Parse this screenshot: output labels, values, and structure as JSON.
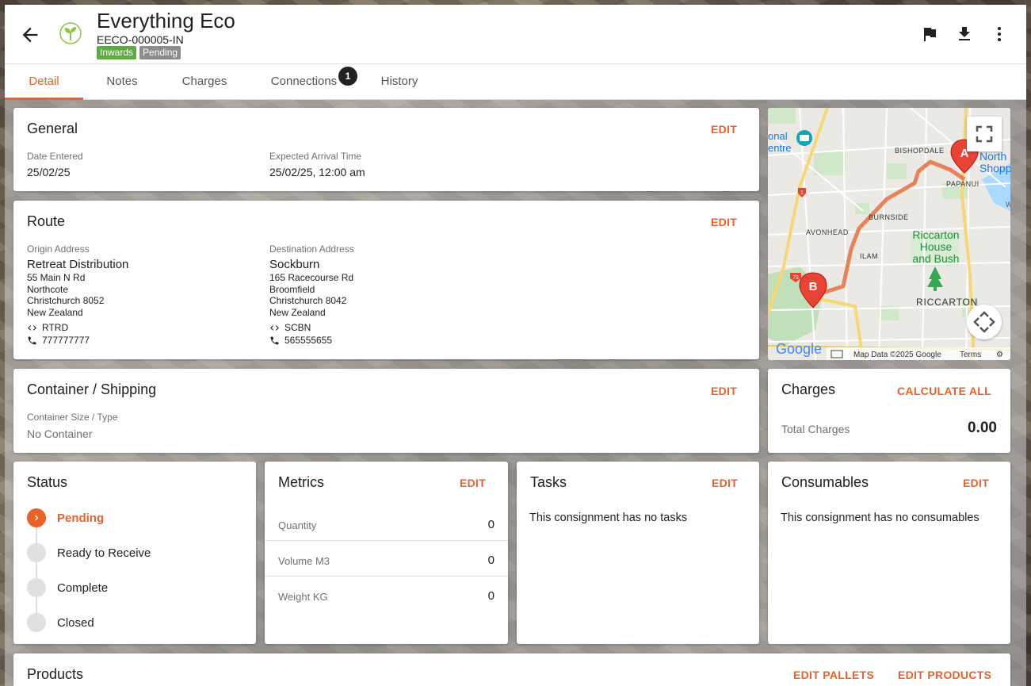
{
  "header": {
    "title": "Everything Eco",
    "reference": "EECO-000005-IN",
    "badges": [
      {
        "label": "Inwards",
        "color": "#5fa845"
      },
      {
        "label": "Pending",
        "color": "#8c8c8c"
      }
    ],
    "icons": [
      "arrow-back-icon",
      "sprout-logo-icon",
      "flag-icon",
      "download-icon",
      "more-vert-icon"
    ]
  },
  "tabs": [
    {
      "label": "Detail",
      "active": true
    },
    {
      "label": "Notes"
    },
    {
      "label": "Charges"
    },
    {
      "label": "Connections",
      "count": "1"
    },
    {
      "label": "History"
    }
  ],
  "general": {
    "title": "General",
    "edit_label": "EDIT",
    "date_entered_label": "Date Entered",
    "date_entered": "25/02/25",
    "expected_arrival_label": "Expected Arrival Time",
    "expected_arrival": "25/02/25, 12:00 am"
  },
  "route": {
    "title": "Route",
    "edit_label": "EDIT",
    "origin": {
      "label": "Origin Address",
      "name": "Retreat Distribution",
      "lines": [
        "55 Main N Rd",
        "Northcote",
        "Christchurch 8052",
        "New Zealand"
      ],
      "code": "RTRD",
      "phone": "777777777"
    },
    "destination": {
      "label": "Destination Address",
      "name": "Sockburn",
      "lines": [
        "165 Racecourse Rd",
        "Broomfield",
        "Christchurch 8042",
        "New Zealand"
      ],
      "code": "SCBN",
      "phone": "565555655"
    }
  },
  "map": {
    "place_labels": [
      "onal",
      "entre",
      "BISHOPDALE",
      "North",
      "Shopp",
      "PAPANUI",
      "BURNSIDE",
      "AVONHEAD",
      "ILAM",
      "Riccarton",
      "House",
      "and Bush",
      "RICCARTON",
      "W"
    ],
    "marker_a": "A",
    "marker_b": "B",
    "road_shields": [
      "1",
      "73"
    ],
    "brand": "Google",
    "attribution": "Map Data ©2025 Google",
    "terms": "Terms",
    "route_color": "#e8825a"
  },
  "container": {
    "title": "Container / Shipping",
    "edit_label": "EDIT",
    "size_label": "Container Size / Type",
    "size_value": "No Container"
  },
  "charges": {
    "title": "Charges",
    "calculate_label": "CALCULATE ALL",
    "total_label": "Total Charges",
    "total_value": "0.00"
  },
  "status": {
    "title": "Status",
    "steps": [
      {
        "label": "Pending",
        "active": true
      },
      {
        "label": "Ready to Receive"
      },
      {
        "label": "Complete"
      },
      {
        "label": "Closed"
      }
    ]
  },
  "metrics": {
    "title": "Metrics",
    "edit_label": "EDIT",
    "rows": [
      {
        "label": "Quantity",
        "value": "0"
      },
      {
        "label": "Volume M3",
        "value": "0"
      },
      {
        "label": "Weight KG",
        "value": "0"
      }
    ]
  },
  "tasks": {
    "title": "Tasks",
    "edit_label": "EDIT",
    "empty_text": "This consignment has no tasks"
  },
  "consumables": {
    "title": "Consumables",
    "edit_label": "EDIT",
    "empty_text": "This consignment has no consumables"
  },
  "products": {
    "title": "Products",
    "edit_pallets_label": "EDIT PALLETS",
    "edit_products_label": "EDIT PRODUCTS"
  },
  "colors": {
    "accent": "#e8622a",
    "inwards_badge": "#5fa845",
    "pending_badge": "#8c8c8c"
  }
}
